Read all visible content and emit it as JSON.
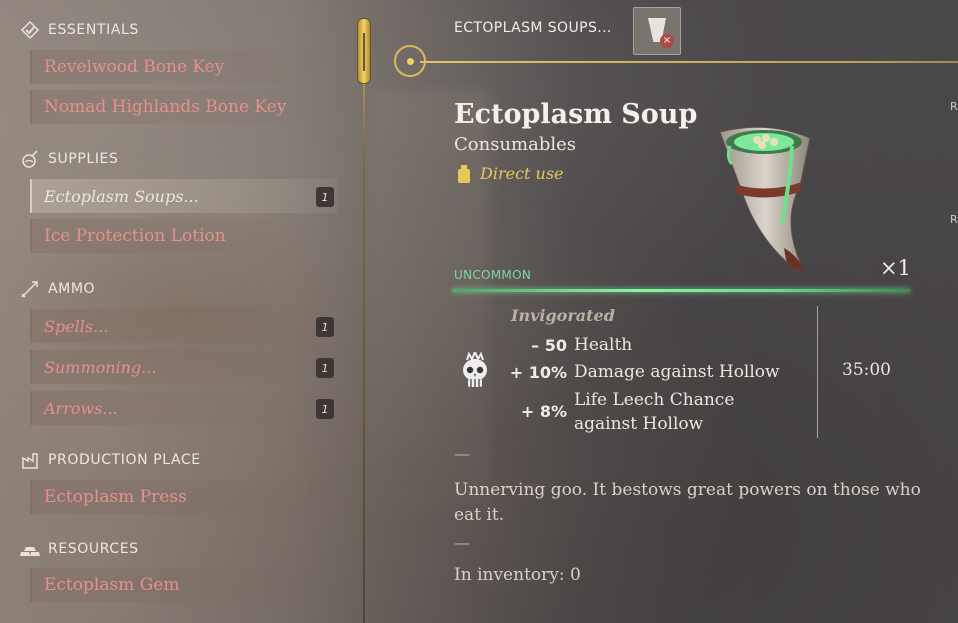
{
  "sidebar": {
    "sections": [
      {
        "title": "ESSENTIALS",
        "icon": "checkmark-icon",
        "items": [
          {
            "label": "Revelwood Bone Key"
          },
          {
            "label": "Nomad Highlands Bone Key"
          }
        ]
      },
      {
        "title": "SUPPLIES",
        "icon": "flask-icon",
        "items": [
          {
            "label": "Ectoplasm Soups...",
            "count": "1",
            "selected": true
          },
          {
            "label": "Ice Protection Lotion"
          }
        ]
      },
      {
        "title": "AMMO",
        "icon": "arrow-icon",
        "items": [
          {
            "label": "Spells...",
            "count": "1"
          },
          {
            "label": "Summoning...",
            "count": "1"
          },
          {
            "label": "Arrows...",
            "count": "1"
          }
        ]
      },
      {
        "title": "PRODUCTION PLACE",
        "icon": "production-icon",
        "items": [
          {
            "label": "Ectoplasm Press"
          }
        ]
      },
      {
        "title": "RESOURCES",
        "icon": "ingots-icon",
        "items": [
          {
            "label": "Ectoplasm Gem"
          }
        ]
      }
    ]
  },
  "header": {
    "title": "ECTOPLASM SOUPS...",
    "thumb_icon": "ectoplasm-soup-icon"
  },
  "detail": {
    "name": "Ectoplasm Soup",
    "category": "Consumables",
    "usage": "Direct use",
    "rarity": "UNCOMMON",
    "quantity": "×1",
    "effect": {
      "name": "Invigorated",
      "icon": "skull-icon",
      "stats": [
        {
          "value": "– 50",
          "label": "Health"
        },
        {
          "value": "+ 10%",
          "label": "Damage against Hollow"
        },
        {
          "value": "+ 8%",
          "label": "Life Leech Chance against Hollow"
        }
      ],
      "duration": "35:00"
    },
    "separator": "—",
    "description": "Unnerving goo. It bestows great powers on those who eat it.",
    "inventory": "In inventory: 0"
  },
  "edge_letters": [
    "R",
    "R"
  ],
  "colors": {
    "item_text": "#e58f8f",
    "gold": "#d9b95b",
    "rarity_green": "#7ed89c",
    "direct_use": "#e8c65a"
  }
}
